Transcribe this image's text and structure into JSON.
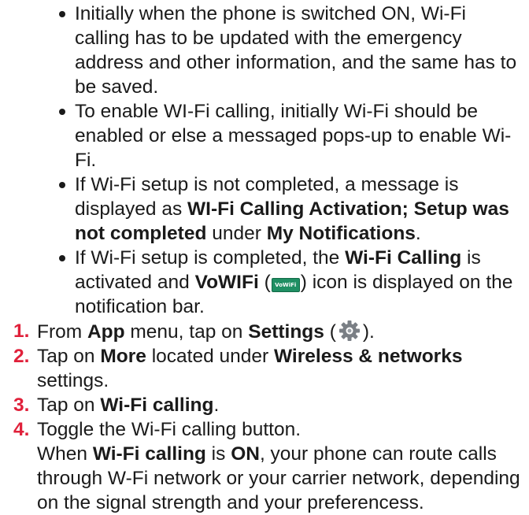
{
  "bullets": {
    "b1": {
      "text": "Initially when the phone is switched ON, Wi-Fi calling has to be updated with the emergency address and other information, and the same has to be saved."
    },
    "b2": {
      "text": "To enable WI-Fi calling, initially Wi-Fi should be enabled or else a messaged pops-up to enable Wi-Fi."
    },
    "b3": {
      "t1": "If Wi-Fi setup is not completed, a message is displayed as ",
      "bold1": "WI-Fi Calling Activation; Setup was not completed",
      "t2": " under ",
      "bold2": "My Notifications",
      "t3": "."
    },
    "b4": {
      "t1": "If Wi-Fi setup is completed, the ",
      "bold1": "Wi-Fi Calling",
      "t2": " is activated and ",
      "bold2": "VoWIFi",
      "t3": " (",
      "icon_label": "VoWiFi",
      "t4": ") icon is displayed on the notification bar."
    }
  },
  "steps": {
    "s1": {
      "num": "1.",
      "t1": "From ",
      "bold1": "App",
      "t2": " menu, tap on ",
      "bold2": "Settings",
      "t3": " (",
      "t4": ")."
    },
    "s2": {
      "num": "2.",
      "t1": "Tap on ",
      "bold1": "More",
      "t2": " located under ",
      "bold2": "Wireless & networks",
      "t3": " settings."
    },
    "s3": {
      "num": "3.",
      "t1": "Tap on ",
      "bold1": "Wi-Fi calling",
      "t2": "."
    },
    "s4": {
      "num": "4.",
      "t1": "Toggle the Wi-Fi calling button.",
      "t2": "When ",
      "bold1": "Wi-Fi calling",
      "t3": " is ",
      "bold2": "ON",
      "t4": ", your phone can route calls through W-Fi network or your carrier network, depending on the signal strength and your preferencess."
    }
  },
  "icons": {
    "vowifi": "vowifi-icon",
    "settings": "gear-icon"
  },
  "colors": {
    "step_number": "#e0203a",
    "text": "#1a1a1a",
    "vowifi_icon": "#1f8f63",
    "gear_icon": "#7a7f85"
  }
}
